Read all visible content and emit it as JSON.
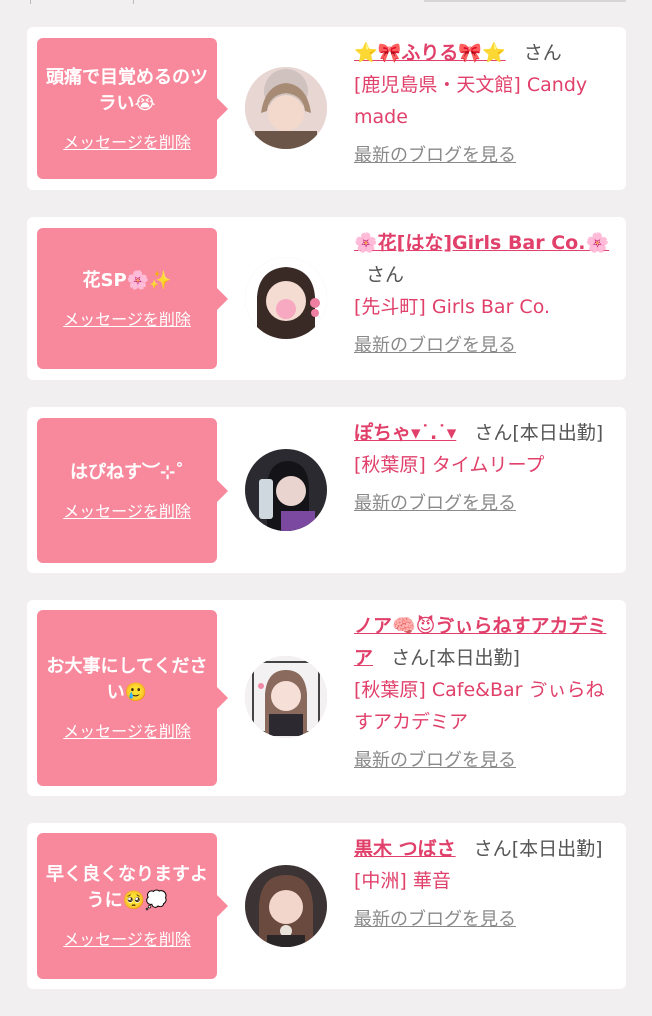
{
  "messages": [
    {
      "message": "頭痛で目覚めるのツラい😭",
      "delete_label": "メッセージを削除",
      "cast_name": "⭐🎀ふりる🎀⭐",
      "honorific": "さん",
      "status": "",
      "shop": "[鹿児島県・天文館] Candy made",
      "blog_label": "最新のブログを見る"
    },
    {
      "message": "花SP🌸✨",
      "delete_label": "メッセージを削除",
      "cast_name": "🌸花[はな]Girls Bar Co.🌸",
      "honorific": "さん",
      "status": "",
      "shop": "[先斗町] Girls Bar Co.",
      "blog_label": "最新のブログを見る"
    },
    {
      "message": "はぴねす︶⊹˚",
      "delete_label": "メッセージを削除",
      "cast_name": "ぽちゃ▾˙.˙▾",
      "honorific": "さん",
      "status": "[本日出勤]",
      "shop": "[秋葉原] タイムリープ",
      "blog_label": "最新のブログを見る"
    },
    {
      "message": "お大事にしてください🥲",
      "delete_label": "メッセージを削除",
      "cast_name": "ノア🧠😈ゔぃらねすアカデミア",
      "honorific": "さん",
      "status": "[本日出勤]",
      "shop": "[秋葉原] Cafe&Bar ゔぃらねすアカデミア",
      "blog_label": "最新のブログを見る"
    },
    {
      "message": "早く良くなりますように🥺💭",
      "delete_label": "メッセージを削除",
      "cast_name": "黒木 つばさ",
      "honorific": "さん",
      "status": "[本日出勤]",
      "shop": "[中洲] 華音",
      "blog_label": "最新のブログを見る"
    }
  ],
  "colors": {
    "bubble": "#f8899c",
    "accent": "#e0406a",
    "muted": "#8a8a8a",
    "background": "#f1efef"
  }
}
